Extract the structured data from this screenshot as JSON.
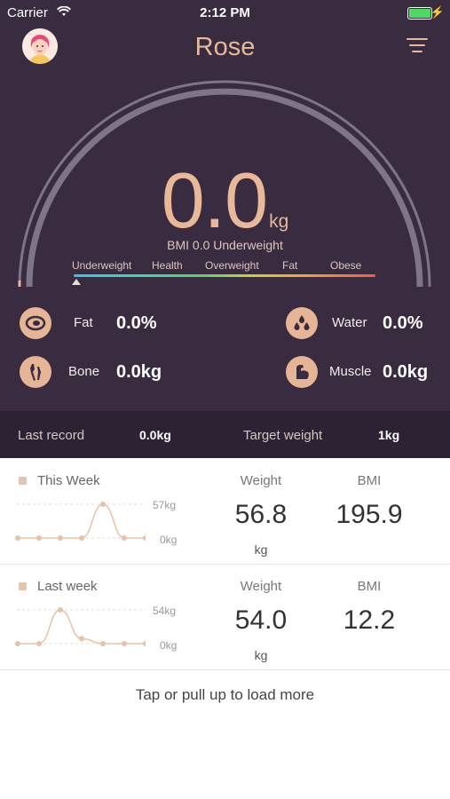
{
  "status_bar": {
    "carrier": "Carrier",
    "time": "2:12 PM"
  },
  "header": {
    "title": "Rose"
  },
  "gauge": {
    "weight": "0.0",
    "unit": "kg",
    "bmi_text": "BMI 0.0 Underweight",
    "scale_labels": [
      "Underweight",
      "Health",
      "Overweight",
      "Fat",
      "Obese"
    ],
    "pointer_fraction": 0.0
  },
  "metrics": {
    "fat": {
      "label": "Fat",
      "value": "0.0%",
      "icon": "fat-icon"
    },
    "water": {
      "label": "Water",
      "value": "0.0%",
      "icon": "water-icon"
    },
    "bone": {
      "label": "Bone",
      "value": "0.0kg",
      "icon": "bone-icon"
    },
    "muscle": {
      "label": "Muscle",
      "value": "0.0kg",
      "icon": "muscle-icon"
    }
  },
  "summary": {
    "last_record_label": "Last record",
    "last_record_value": "0.0kg",
    "target_label": "Target weight",
    "target_value": "1kg"
  },
  "this_week": {
    "label": "This Week",
    "chart_top_label": "57kg",
    "chart_bottom_label": "0kg",
    "chart_values": [
      0,
      0,
      0,
      0,
      57,
      0,
      0
    ],
    "weight_header": "Weight",
    "weight_value": "56.8",
    "weight_unit": "kg",
    "bmi_header": "BMI",
    "bmi_value": "195.9"
  },
  "last_week": {
    "label": "Last week",
    "chart_top_label": "54kg",
    "chart_bottom_label": "0kg",
    "chart_values": [
      0,
      0,
      54,
      8,
      0,
      0,
      0
    ],
    "weight_header": "Weight",
    "weight_value": "54.0",
    "weight_unit": "kg",
    "bmi_header": "BMI",
    "bmi_value": "12.2"
  },
  "footer": {
    "load_more": "Tap or pull up to load more"
  },
  "colors": {
    "background": "#392c40",
    "accent": "#e8b898",
    "icon_bg": "#e6b596"
  }
}
